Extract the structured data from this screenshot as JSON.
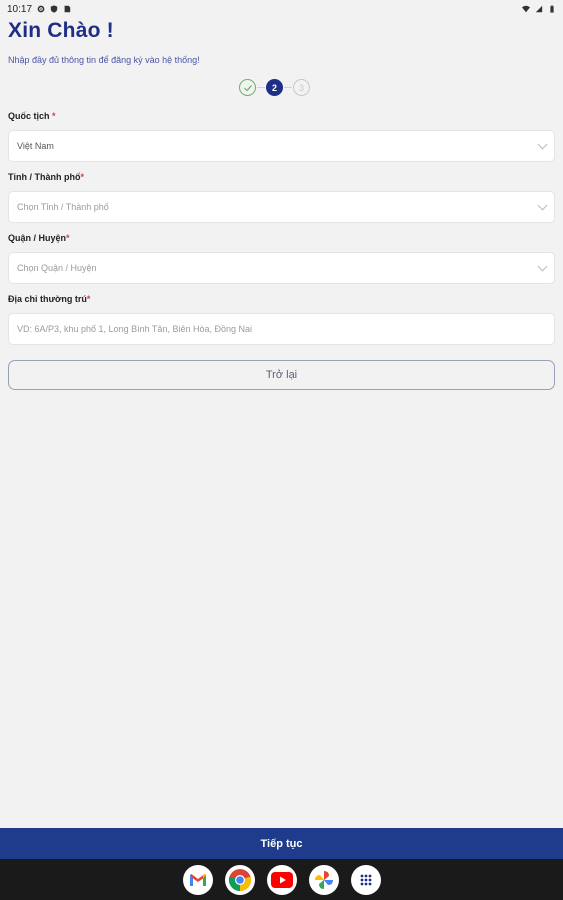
{
  "status_bar": {
    "time": "10:17"
  },
  "header": {
    "greeting": "Xin Chào !",
    "subtitle": "Nhập đầy đủ thông tin để đăng ký vào hệ thống!"
  },
  "stepper": {
    "step2": "2",
    "step3": "3"
  },
  "fields": {
    "nationality": {
      "label": "Quốc tịch",
      "value": "Việt Nam"
    },
    "province": {
      "label": "Tỉnh / Thành phố",
      "placeholder": "Chọn Tỉnh / Thành phố"
    },
    "district": {
      "label": "Quận / Huyện",
      "placeholder": "Chọn Quận / Huyện"
    },
    "address": {
      "label": "Địa chỉ thường trú",
      "placeholder": "VD: 6A/P3, khu phố 1, Long Bình Tân, Biên Hòa, Đồng Nai"
    },
    "required_mark": "*"
  },
  "buttons": {
    "back": "Trở lại",
    "continue": "Tiếp tục"
  },
  "colors": {
    "primary": "#1f2f86",
    "continue_bg": "#1f3c8c",
    "success": "#6ab36c",
    "required": "#e03a3a"
  },
  "nav_apps": [
    "gmail-icon",
    "chrome-icon",
    "youtube-icon",
    "photos-icon",
    "app-drawer-icon"
  ]
}
